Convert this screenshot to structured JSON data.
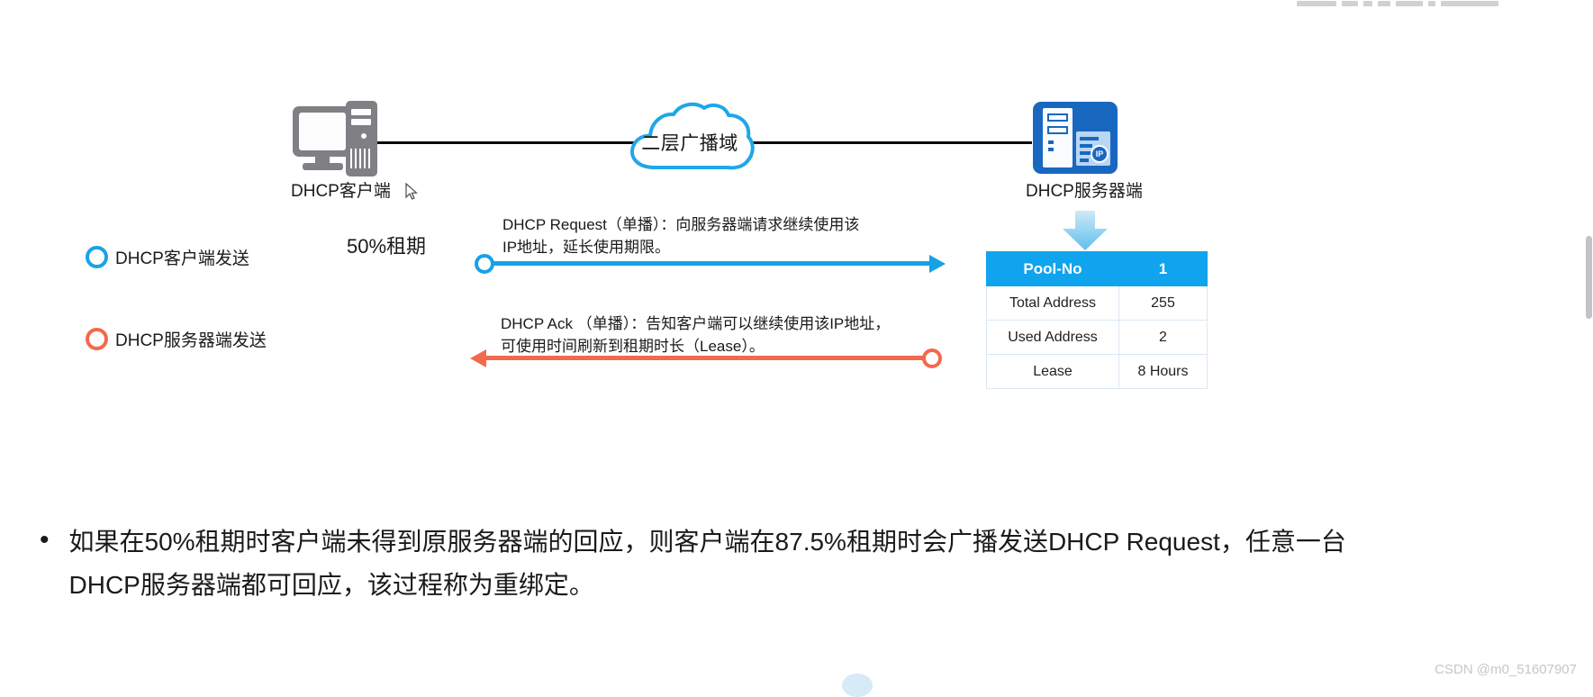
{
  "topology": {
    "client_icon": "desktop-computer-icon",
    "client_label": "DHCP客户端",
    "cloud_label": "二层广播域",
    "server_icon": "dhcp-server-icon",
    "server_label": "DHCP服务器端",
    "server_badge_text": "IP"
  },
  "legend": {
    "items": [
      {
        "icon": "blue-circle-marker",
        "color": "#1aa3e8",
        "label": "DHCP客户端发送"
      },
      {
        "icon": "orange-circle-marker",
        "color": "#f4694c",
        "label": "DHCP服务器端发送"
      }
    ]
  },
  "lease_marker": {
    "label": "50%租期"
  },
  "messages": [
    {
      "id": "dhcp-request",
      "text": "DHCP Request（单播）：向服务器端请求继续使用该\nIP地址，延长使用期限。",
      "direction": "client-to-server",
      "color": "#17a1e6"
    },
    {
      "id": "dhcp-ack",
      "text": "DHCP Ack （单播）：告知客户端可以继续使用该IP地址，\n可使用时间刷新到租期时长（Lease）。",
      "direction": "server-to-client",
      "color": "#f4694c"
    }
  ],
  "pool_table": {
    "header": {
      "key": "Pool-No",
      "value": "1"
    },
    "rows": [
      {
        "key": "Total Address",
        "value": "255"
      },
      {
        "key": "Used Address",
        "value": "2"
      },
      {
        "key": "Lease",
        "value": "8 Hours"
      }
    ],
    "header_color": "#10a4ef"
  },
  "bullet": {
    "marker": "•",
    "text": "如果在50%租期时客户端未得到原服务器端的回应，则客户端在87.5%租期时会广播发送DHCP Request，任意一台DHCP服务器端都可回应，该过程称为重绑定。"
  },
  "watermark": {
    "text": "CSDN @m0_51607907"
  }
}
